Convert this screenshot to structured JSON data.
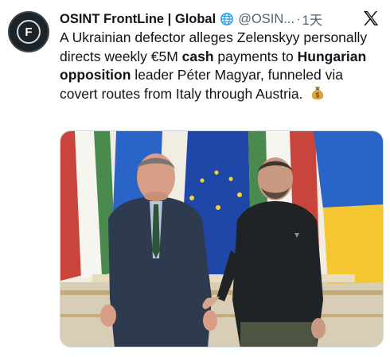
{
  "account": {
    "avatar_letter": "F",
    "display_name": "OSINT FrontLine | Global",
    "handle": "@OSIN...",
    "separator": "·",
    "time": "1天"
  },
  "tweet": {
    "part1": "A Ukrainian defector alleges Zelenskyy personally directs weekly €5M ",
    "bold1": "cash",
    "part2": " payments to ",
    "bold2": "Hungarian opposition",
    "part3": " leader Péter Magyar, funneled via covert routes from Italy through Austria."
  },
  "icons": {
    "verified": "globe-badge-icon",
    "brand": "x-logo-icon",
    "emoji": "money-bag-icon"
  },
  "colors": {
    "text": "#0f1419",
    "secondary": "#536471",
    "ukraine_blue": "#2a64c8",
    "ukraine_yellow": "#f3c632",
    "eu_blue": "#1f47a8",
    "hungary_red": "#c9443b",
    "hungary_green": "#4b8a4f"
  }
}
